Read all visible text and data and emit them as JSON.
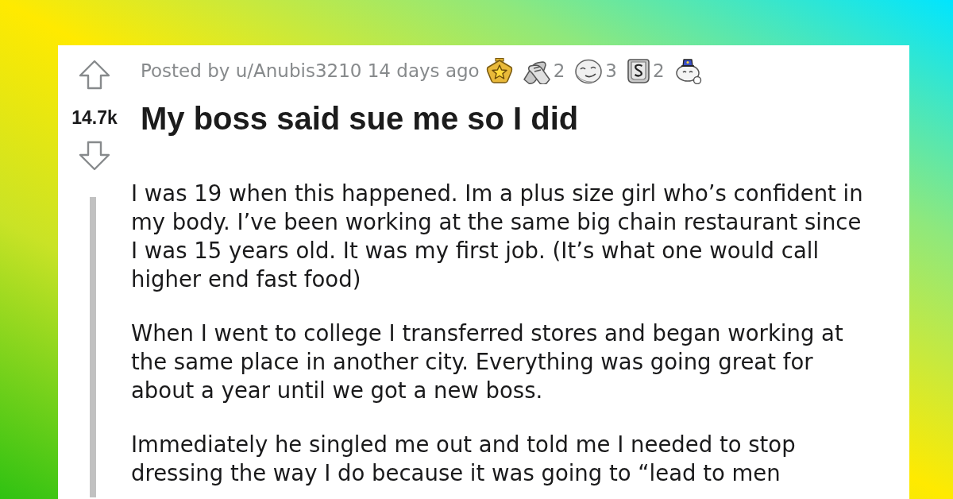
{
  "vote": {
    "score": "14.7k"
  },
  "header": {
    "posted_by": "Posted by u/Anubis3210 14 days ago",
    "award_counts": [
      "2",
      "3",
      "2"
    ],
    "title": "My boss said sue me so I did"
  },
  "body": {
    "paragraphs": [
      "I was 19 when this happened. Im a plus size girl who’s confident in my body. I’ve been working at the same big chain restaurant since I was 15 years old. It was my first job. (It’s what one would call higher end fast food)",
      "When I went to college I transferred stores and began working at the same place in another city. Everything was going great for about a year until we got a new boss.",
      "Immediately he singled me out and told me I needed to stop dressing the way I do because it was going to “lead to men"
    ]
  }
}
